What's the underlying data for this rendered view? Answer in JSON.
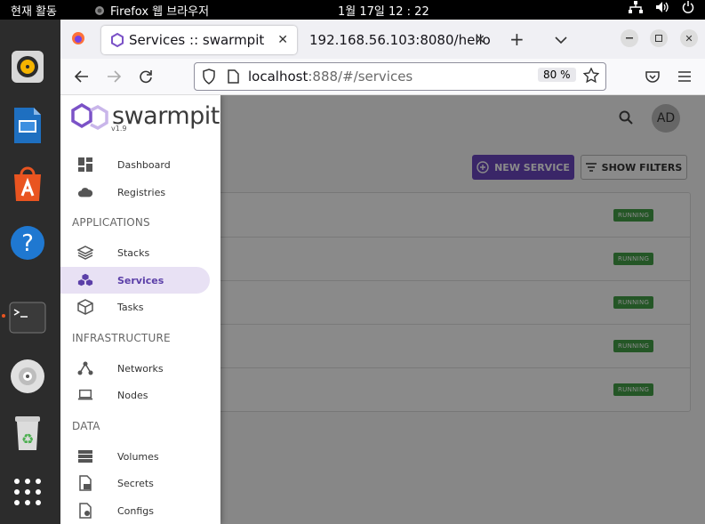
{
  "topbar": {
    "activities": "현재 활동",
    "app_name": "Firefox 웹 브라우저",
    "clock": "1월 17일  12 : 22"
  },
  "dock": {
    "items": [
      "rhythmbox-icon",
      "libreoffice-impress-icon",
      "app-center-icon",
      "help-icon",
      "terminal-icon",
      "dvd-icon",
      "trash-icon",
      "app-grid-icon"
    ]
  },
  "browser": {
    "tabs": [
      {
        "title": "Services :: swarmpit",
        "active": true
      },
      {
        "title": "192.168.56.103:8080/hello",
        "active": false
      }
    ],
    "url_host": "localhost",
    "url_rest": ":888/#/services",
    "zoom": "80 %"
  },
  "header": {
    "avatar_initials": "AD"
  },
  "toolbar": {
    "new_service_label": "NEW SERVICE",
    "show_filters_label": "SHOW FILTERS"
  },
  "services": {
    "rows": [
      {
        "status": "RUNNING"
      },
      {
        "status": "RUNNING"
      },
      {
        "status": "RUNNING"
      },
      {
        "status": "RUNNING"
      },
      {
        "status": "RUNNING"
      }
    ]
  },
  "sidebar": {
    "logo_text": "swarmpit",
    "version": "v1.9",
    "items": [
      {
        "label": "Dashboard",
        "icon": "dashboard-icon"
      },
      {
        "label": "Registries",
        "icon": "cloud-icon"
      },
      {
        "label": "Stacks",
        "icon": "stacks-icon"
      },
      {
        "label": "Services",
        "icon": "services-icon",
        "active": true
      },
      {
        "label": "Tasks",
        "icon": "tasks-icon"
      },
      {
        "label": "Networks",
        "icon": "networks-icon"
      },
      {
        "label": "Nodes",
        "icon": "nodes-icon"
      },
      {
        "label": "Volumes",
        "icon": "volumes-icon"
      },
      {
        "label": "Secrets",
        "icon": "secrets-icon"
      },
      {
        "label": "Configs",
        "icon": "configs-icon"
      }
    ],
    "sections": [
      "APPLICATIONS",
      "INFRASTRUCTURE",
      "DATA"
    ]
  },
  "colors": {
    "accent": "#6b46c1",
    "running": "#43a047",
    "active_bg": "#e8e1f4"
  }
}
